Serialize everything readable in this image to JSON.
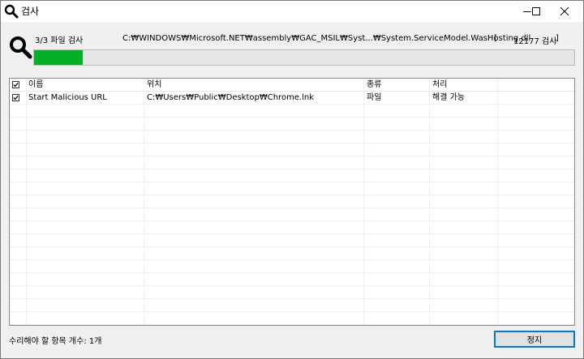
{
  "window": {
    "title": "검사",
    "controls": [
      "minimize-icon",
      "maximize-icon",
      "close-icon"
    ]
  },
  "scan": {
    "file_count": "3/3 파일 검사",
    "current_path": "C:₩WINDOWS₩Microsoft.NET₩assembly₩GAC_MSIL₩Syst...₩System.ServiceModel.WasHosting.dll",
    "bracket_left": "[",
    "count": "12177 검사",
    "bracket_right": "]",
    "progress_percent": 9
  },
  "table": {
    "columns": [
      "이름",
      "위치",
      "종류",
      "처리"
    ],
    "rows": [
      {
        "checked": true,
        "name": "Start Malicious URL",
        "location": "C:₩Users₩Public₩Desktop₩Chrome.lnk",
        "type": "파일",
        "action": "해결 가능"
      }
    ]
  },
  "footer": {
    "status": "수리해야 할 항목 개수: 1개",
    "stop_label": "정지"
  },
  "colors": {
    "progress": "#06b025",
    "accent": "#0078d7"
  }
}
